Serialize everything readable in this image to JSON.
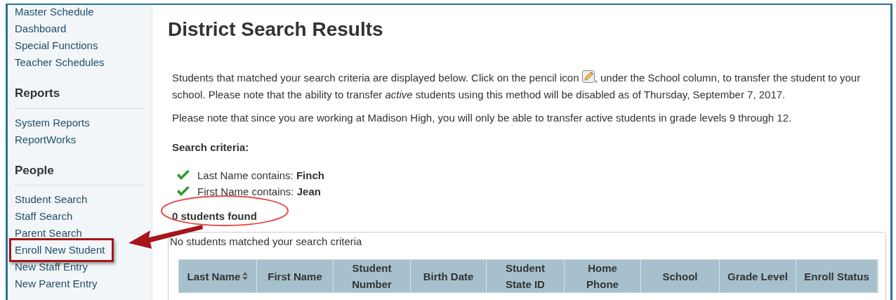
{
  "sidebar": {
    "groups": [
      {
        "items": [
          {
            "label": "Master Schedule",
            "highlighted": false
          },
          {
            "label": "Dashboard",
            "highlighted": false
          },
          {
            "label": "Special Functions",
            "highlighted": false
          },
          {
            "label": "Teacher Schedules",
            "highlighted": false
          }
        ]
      },
      {
        "heading": "Reports",
        "items": [
          {
            "label": "System Reports",
            "highlighted": false
          },
          {
            "label": "ReportWorks",
            "highlighted": false
          }
        ]
      },
      {
        "heading": "People",
        "items": [
          {
            "label": "Student Search",
            "highlighted": false
          },
          {
            "label": "Staff Search",
            "highlighted": false
          },
          {
            "label": "Parent Search",
            "highlighted": false
          },
          {
            "label": "Enroll New Student",
            "highlighted": true
          },
          {
            "label": "New Staff Entry",
            "highlighted": false
          },
          {
            "label": "New Parent Entry",
            "highlighted": false
          }
        ]
      }
    ]
  },
  "page_title": "District Search Results",
  "intro": {
    "before_icon": "Students that matched your search criteria are displayed below. Click on the pencil icon",
    "after_icon": ", under the School column, to transfer the student to your school. Please note that the ability to transfer *active* students using this method will be disabled as of Thursday, September 7, 2017."
  },
  "note": "Please note that since you are working at Madison High, you will only be able to transfer active students in grade levels 9 through 12.",
  "criteria": {
    "heading": "Search criteria:",
    "items": [
      {
        "label": "Last Name contains: ",
        "value": "Finch"
      },
      {
        "label": "First Name contains: ",
        "value": "Jean"
      }
    ]
  },
  "result_count": {
    "text": "0 students found",
    "circled": true
  },
  "results": {
    "message": "No students matched your search criteria",
    "columns": [
      {
        "label": "Last Name",
        "sortable": true
      },
      {
        "label": "First Name",
        "sortable": false
      },
      {
        "label": "Student Number",
        "sortable": false
      },
      {
        "label": "Birth Date",
        "sortable": false
      },
      {
        "label": "Student State ID",
        "sortable": false
      },
      {
        "label": "Home Phone",
        "sortable": false
      },
      {
        "label": "School",
        "sortable": false
      },
      {
        "label": "Grade Level",
        "sortable": false
      },
      {
        "label": "Enroll Status",
        "sortable": false
      }
    ]
  }
}
